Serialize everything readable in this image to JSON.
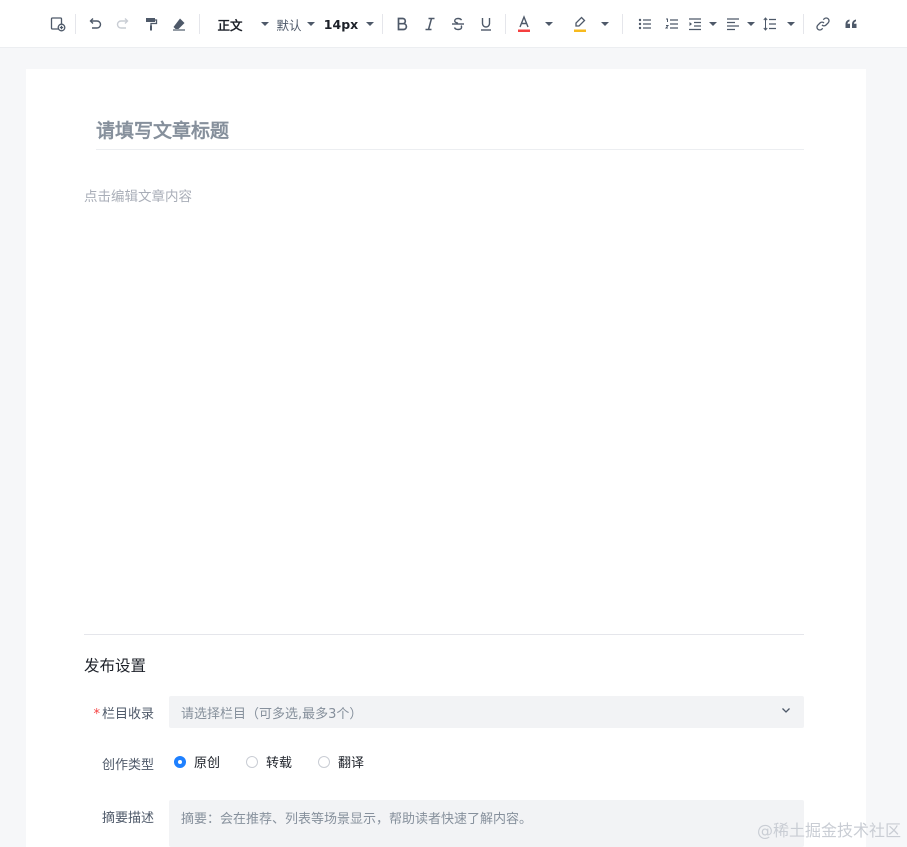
{
  "toolbar": {
    "icons": [
      "insert-template-icon",
      "undo-icon",
      "redo-icon",
      "format-painter-icon",
      "clear-format-icon",
      "bold-icon",
      "italic-icon",
      "strikethrough-icon",
      "underline-icon",
      "font-color-icon",
      "highlight-icon",
      "bullet-list-icon",
      "numbered-list-icon",
      "indent-icon",
      "align-icon",
      "line-height-icon",
      "link-icon",
      "quote-icon"
    ],
    "heading_label": "正文",
    "font_family_label": "默认",
    "font_size_label": "14px",
    "colors": {
      "font_color": "#f53f3f",
      "highlight_color": "#f7ba1e"
    }
  },
  "editor": {
    "title_placeholder": "请填写文章标题",
    "content_placeholder": "点击编辑文章内容"
  },
  "publish": {
    "section_title": "发布设置",
    "column_label": "栏目收录",
    "column_placeholder": "请选择栏目（可多选,最多3个）",
    "type_label": "创作类型",
    "type_options": [
      {
        "label": "原创",
        "checked": true
      },
      {
        "label": "转载",
        "checked": false
      },
      {
        "label": "翻译",
        "checked": false
      }
    ],
    "summary_label": "摘要描述",
    "summary_placeholder": "摘要：会在推荐、列表等场景显示，帮助读者快速了解内容。"
  },
  "watermark": "@稀土掘金技术社区",
  "colors": {
    "accent": "#1e80ff",
    "required": "#f53f3f",
    "page_bg": "#f6f7f9"
  }
}
